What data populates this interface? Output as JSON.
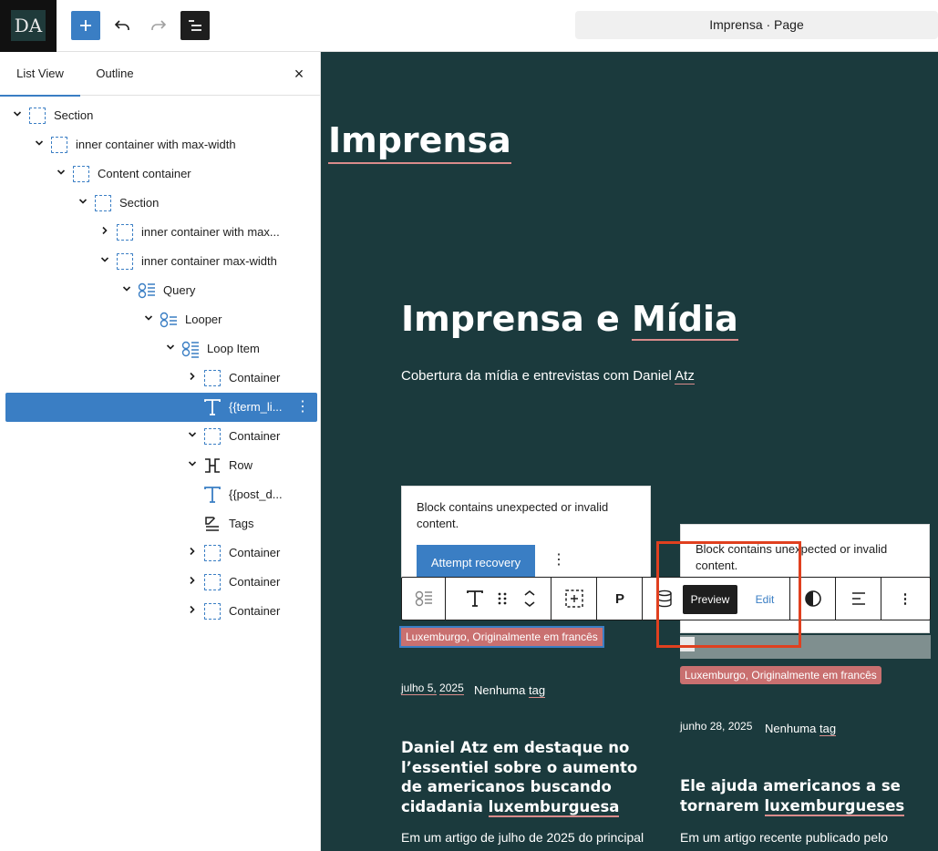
{
  "topbar": {
    "logo_text": "DA",
    "add_label": "+",
    "doc_title": "Imprensa · Page"
  },
  "panel": {
    "tabs": [
      "List View",
      "Outline"
    ],
    "close_label": "×",
    "tree": [
      {
        "label": "Section",
        "icon": "dashed-container-icon",
        "chevron": "down",
        "indent": 0
      },
      {
        "label": "inner container with max-width",
        "icon": "dashed-container-icon",
        "chevron": "down",
        "indent": 1
      },
      {
        "label": "Content container",
        "icon": "dashed-container-icon",
        "chevron": "down",
        "indent": 2
      },
      {
        "label": "Section",
        "icon": "dashed-container-icon",
        "chevron": "down",
        "indent": 3
      },
      {
        "label": "inner container with max...",
        "icon": "dashed-container-icon",
        "chevron": "right",
        "indent": 4
      },
      {
        "label": "inner container max-width",
        "icon": "dashed-container-icon",
        "chevron": "down",
        "indent": 4
      },
      {
        "label": "Query",
        "icon": "query-icon",
        "chevron": "down",
        "indent": 5
      },
      {
        "label": "Looper",
        "icon": "looper-icon",
        "chevron": "down",
        "indent": 6
      },
      {
        "label": "Loop Item",
        "icon": "loop-item-icon",
        "chevron": "down",
        "indent": 7
      },
      {
        "label": "Container",
        "icon": "dashed-container-icon",
        "chevron": "right",
        "indent": 8
      },
      {
        "label": "{{term_li...",
        "icon": "text-icon",
        "chevron": "",
        "indent": 8,
        "selected": true
      },
      {
        "label": "Container",
        "icon": "dashed-container-icon",
        "chevron": "down",
        "indent": 8
      },
      {
        "label": "Row",
        "icon": "row-icon",
        "chevron": "down",
        "indent": 8
      },
      {
        "label": "{{post_d...",
        "icon": "text-icon",
        "chevron": "",
        "indent": 8
      },
      {
        "label": "Tags",
        "icon": "tags-icon",
        "chevron": "",
        "indent": 8
      },
      {
        "label": "Container",
        "icon": "dashed-container-icon",
        "chevron": "right",
        "indent": 8
      },
      {
        "label": "Container",
        "icon": "dashed-container-icon",
        "chevron": "right",
        "indent": 8
      },
      {
        "label": "Container",
        "icon": "dashed-container-icon",
        "chevron": "right",
        "indent": 8
      }
    ]
  },
  "canvas": {
    "page_heading": "Imprensa",
    "section_heading_a": "Imprensa e ",
    "section_heading_b": "Mídia",
    "subtitle_a": "Cobertura da mídia e entrevistas com Daniel ",
    "subtitle_b": "Atz",
    "invalid_text": "Block contains unexpected or invalid content.",
    "recover_label": "Attempt recovery",
    "more_label": "⋮",
    "toolbar": {
      "paragraph_label": "P",
      "preview_label": "Preview",
      "edit_label": "Edit"
    },
    "term_label": "Luxemburgo, Originalmente em francês",
    "post1": {
      "date_a": "julho 5,",
      "date_b": "2025",
      "tags_a": "Nenhuma ",
      "tags_b": "tag",
      "title_plain": "Daniel Atz em destaque no l’essentiel sobre o aumento de americanos buscando cidadania ",
      "title_link": "luxemburguesa",
      "excerpt": "Em um artigo de julho de 2025 do principal"
    },
    "post2": {
      "date": "junho 28, 2025",
      "tags_a": "Nenhuma ",
      "tags_b": "tag",
      "title_plain": "Ele ajuda americanos a se tornarem ",
      "title_link": "luxemburgueses",
      "excerpt": "Em um artigo recente publicado pelo"
    }
  }
}
